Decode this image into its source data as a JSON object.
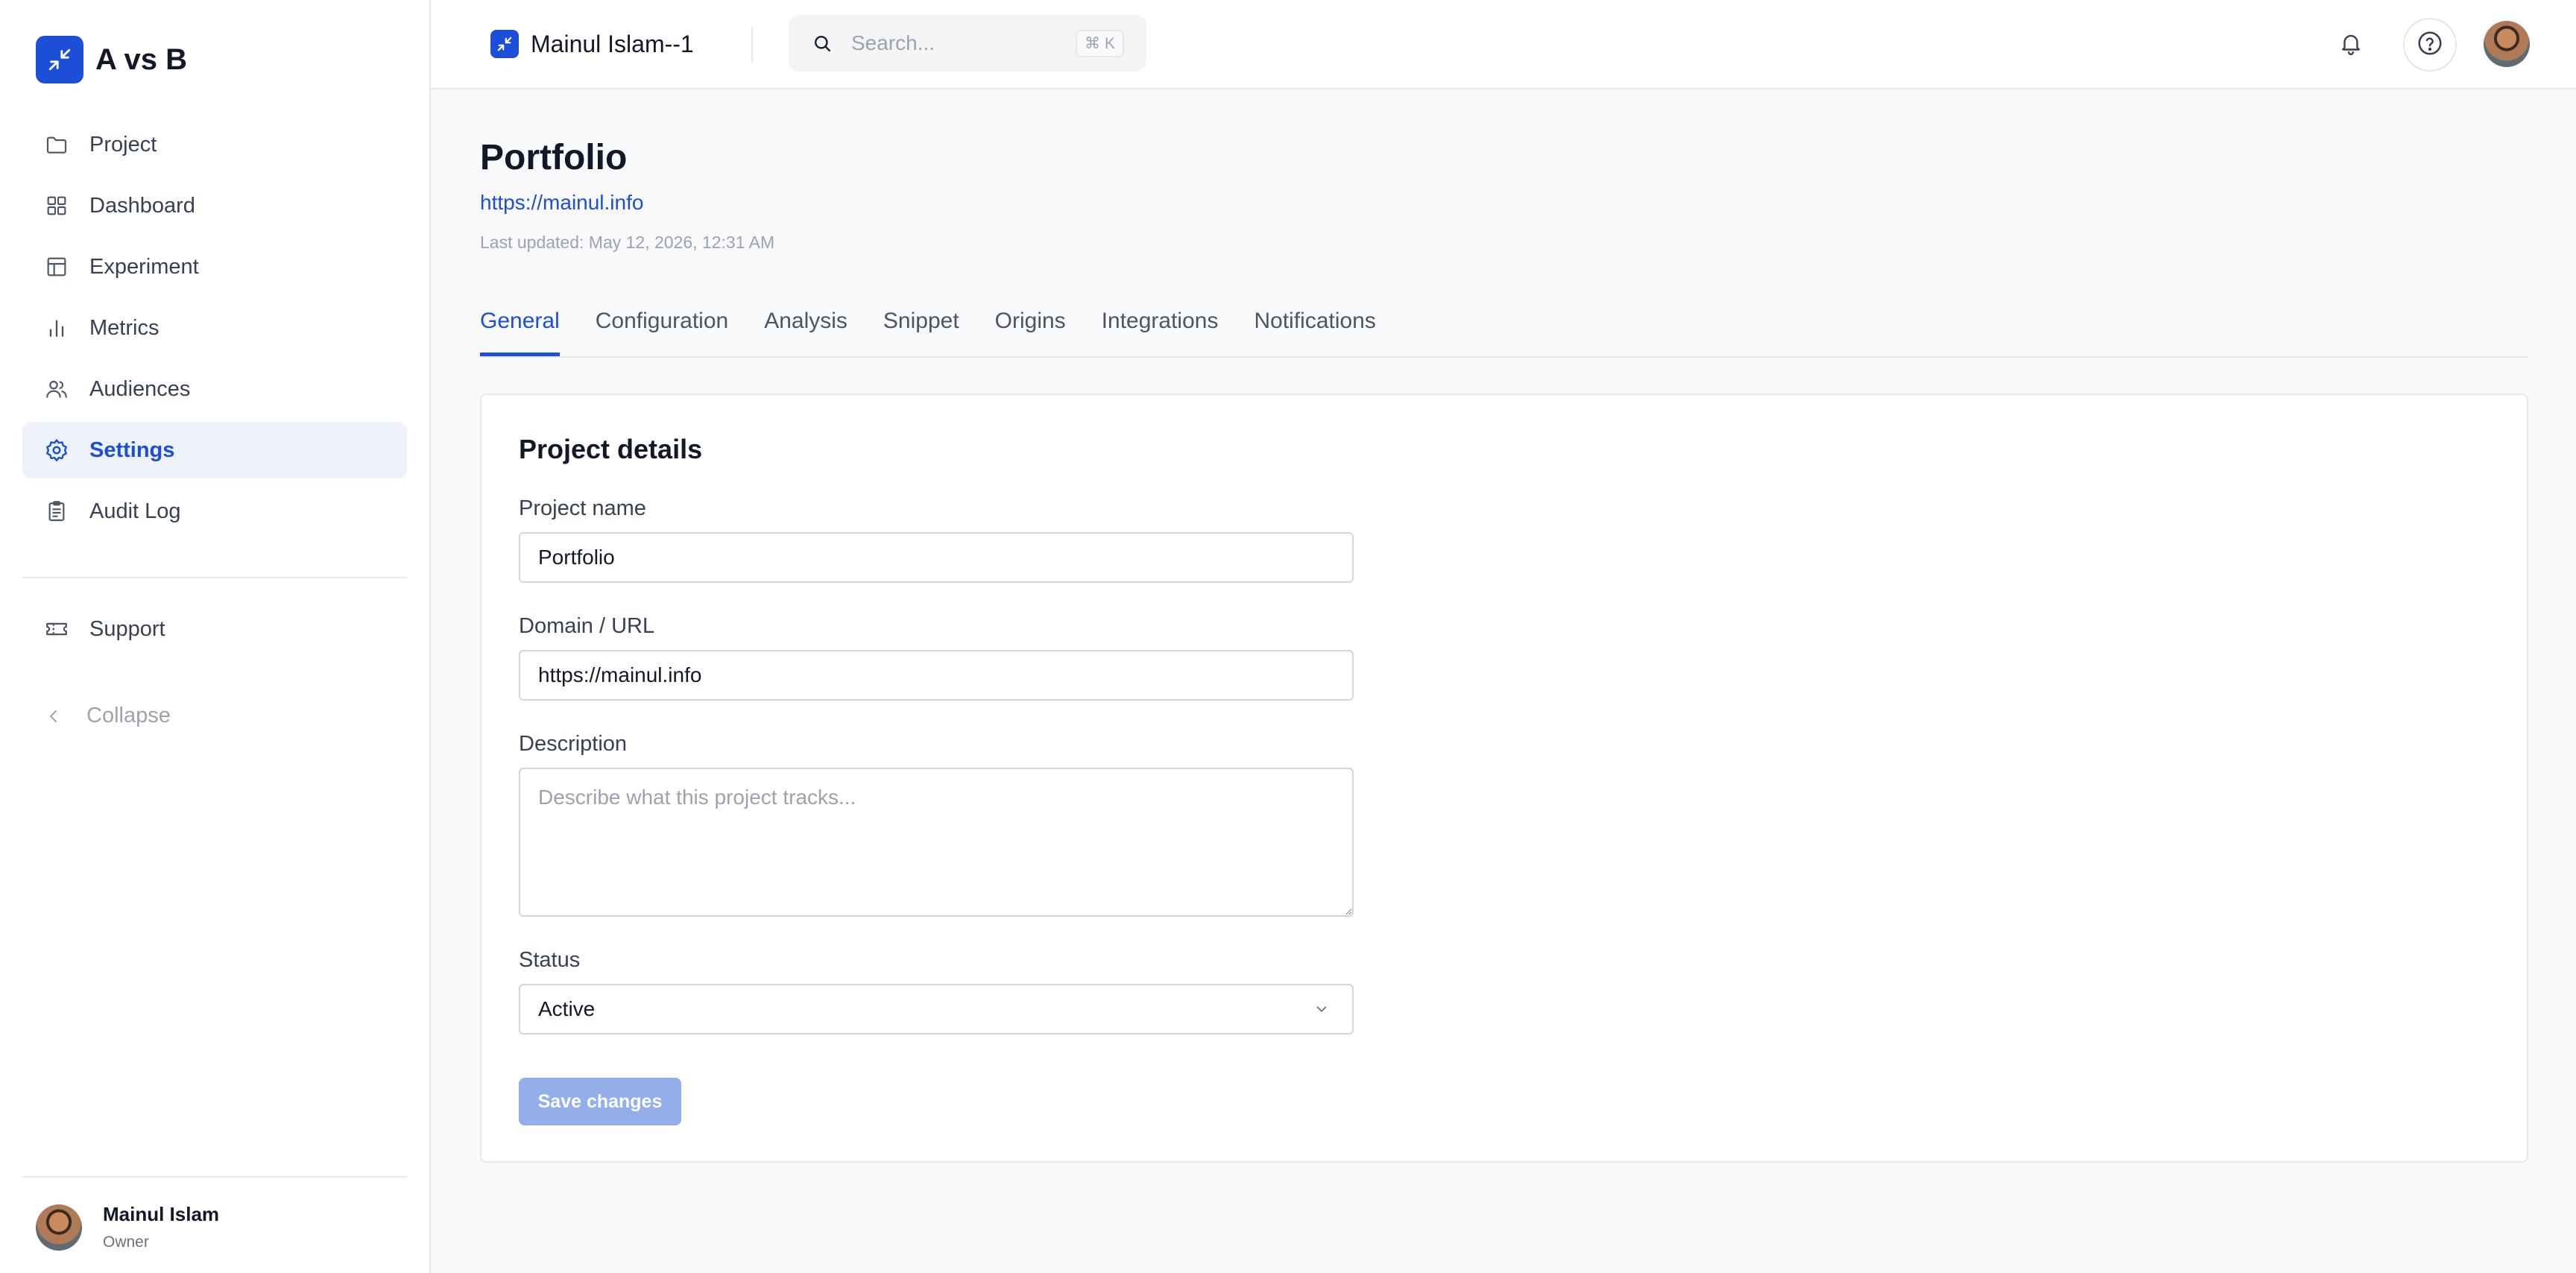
{
  "app": {
    "brand_name": "A vs B",
    "accent_color": "#1d4ed8"
  },
  "sidebar": {
    "items": [
      {
        "label": "Project",
        "icon": "folder-icon"
      },
      {
        "label": "Dashboard",
        "icon": "grid-icon"
      },
      {
        "label": "Experiment",
        "icon": "table-icon"
      },
      {
        "label": "Metrics",
        "icon": "bar-chart-icon"
      },
      {
        "label": "Audiences",
        "icon": "users-icon"
      },
      {
        "label": "Settings",
        "icon": "gear-icon",
        "active": true
      },
      {
        "label": "Audit Log",
        "icon": "clipboard-icon"
      }
    ],
    "support_label": "Support",
    "collapse_label": "Collapse",
    "user": {
      "name": "Mainul Islam",
      "role": "Owner"
    }
  },
  "header": {
    "workspace_name": "Mainul Islam--1",
    "search_placeholder": "Search...",
    "search_shortcut": "⌘ K"
  },
  "page": {
    "title": "Portfolio",
    "url": "https://mainul.info",
    "last_updated": "Last updated: May 12, 2026, 12:31 AM"
  },
  "tabs": [
    "General",
    "Configuration",
    "Analysis",
    "Snippet",
    "Origins",
    "Integrations",
    "Notifications"
  ],
  "active_tab": "General",
  "form": {
    "section_title": "Project details",
    "project_name_label": "Project name",
    "project_name_value": "Portfolio",
    "domain_label": "Domain / URL",
    "domain_value": "https://mainul.info",
    "description_label": "Description",
    "description_placeholder": "Describe what this project tracks...",
    "status_label": "Status",
    "status_value": "Active",
    "save_label": "Save changes"
  }
}
